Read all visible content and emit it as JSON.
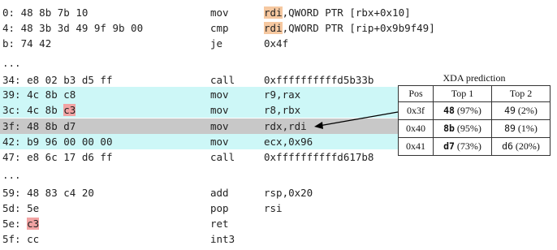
{
  "rows": [
    {
      "offset": "0:",
      "bytes": [
        {
          "t": "48 8b 7b 10"
        }
      ],
      "mnemonic": "mov",
      "operands": [
        {
          "t": "rdi",
          "mark": "orange"
        },
        {
          "t": ",QWORD PTR [rbx+0x10]"
        }
      ]
    },
    {
      "offset": "4:",
      "bytes": [
        {
          "t": "48 3b 3d 49 9f 9b 00"
        }
      ],
      "mnemonic": "cmp",
      "operands": [
        {
          "t": "rdi",
          "mark": "orange"
        },
        {
          "t": ",QWORD PTR [rip+0x9b9f49]"
        }
      ]
    },
    {
      "offset": "b:",
      "bytes": [
        {
          "t": "74 42"
        }
      ],
      "mnemonic": "je",
      "operands": [
        {
          "t": "0x4f"
        }
      ]
    },
    {
      "offset": "...",
      "bytes": [],
      "mnemonic": "",
      "operands": []
    },
    {
      "offset": "34:",
      "bytes": [
        {
          "t": "e8 02 b3 d5 ff"
        }
      ],
      "mnemonic": "call",
      "operands": [
        {
          "t": "0xffffffffffd5b33b"
        }
      ]
    },
    {
      "offset": "39:",
      "bytes": [
        {
          "t": "4c 8b c8"
        }
      ],
      "mnemonic": "mov",
      "operands": [
        {
          "t": "r9,rax"
        }
      ],
      "highlight": "cyan"
    },
    {
      "offset": "3c:",
      "bytes": [
        {
          "t": "4c 8b "
        },
        {
          "t": "c3",
          "mark": "red"
        }
      ],
      "mnemonic": "mov",
      "operands": [
        {
          "t": "r8,rbx"
        }
      ],
      "highlight": "cyan"
    },
    {
      "offset": "3f:",
      "bytes": [
        {
          "t": "48 8b d7"
        }
      ],
      "mnemonic": "mov",
      "operands": [
        {
          "t": "rdx,rdi"
        }
      ],
      "highlight": "gray"
    },
    {
      "offset": "42:",
      "bytes": [
        {
          "t": "b9 96 00 00 00"
        }
      ],
      "mnemonic": "mov",
      "operands": [
        {
          "t": "ecx,0x96"
        }
      ],
      "highlight": "cyan"
    },
    {
      "offset": "47:",
      "bytes": [
        {
          "t": "e8 6c 17 d6 ff"
        }
      ],
      "mnemonic": "call",
      "operands": [
        {
          "t": "0xffffffffffd617b8"
        }
      ]
    },
    {
      "offset": "...",
      "bytes": [],
      "mnemonic": "",
      "operands": []
    },
    {
      "offset": "59:",
      "bytes": [
        {
          "t": "48 83 c4 20"
        }
      ],
      "mnemonic": "add",
      "operands": [
        {
          "t": "rsp,0x20"
        }
      ]
    },
    {
      "offset": "5d:",
      "bytes": [
        {
          "t": "5e"
        }
      ],
      "mnemonic": "pop",
      "operands": [
        {
          "t": "rsi"
        }
      ]
    },
    {
      "offset": "5e:",
      "bytes": [
        {
          "t": "c3",
          "mark": "red"
        }
      ],
      "mnemonic": "ret",
      "operands": []
    },
    {
      "offset": "5f:",
      "bytes": [
        {
          "t": "cc"
        }
      ],
      "mnemonic": "int3",
      "operands": []
    }
  ],
  "xda": {
    "title": "XDA prediction",
    "headers": [
      "Pos",
      "Top 1",
      "Top 2"
    ],
    "rows": [
      {
        "pos": "0x3f",
        "top1_byte": "48",
        "top1_pct": "(97%)",
        "top2_byte": "49",
        "top2_pct": "(2%)"
      },
      {
        "pos": "0x40",
        "top1_byte": "8b",
        "top1_pct": "(95%)",
        "top2_byte": "89",
        "top2_pct": "(1%)"
      },
      {
        "pos": "0x41",
        "top1_byte": "d7",
        "top1_pct": "(73%)",
        "top2_byte": "d6",
        "top2_pct": "(20%)"
      }
    ]
  },
  "colors": {
    "cyan": "#cdf7f7",
    "gray": "#c8c8c8",
    "orange": "#f6c8a0",
    "red": "#f2a3a3"
  }
}
